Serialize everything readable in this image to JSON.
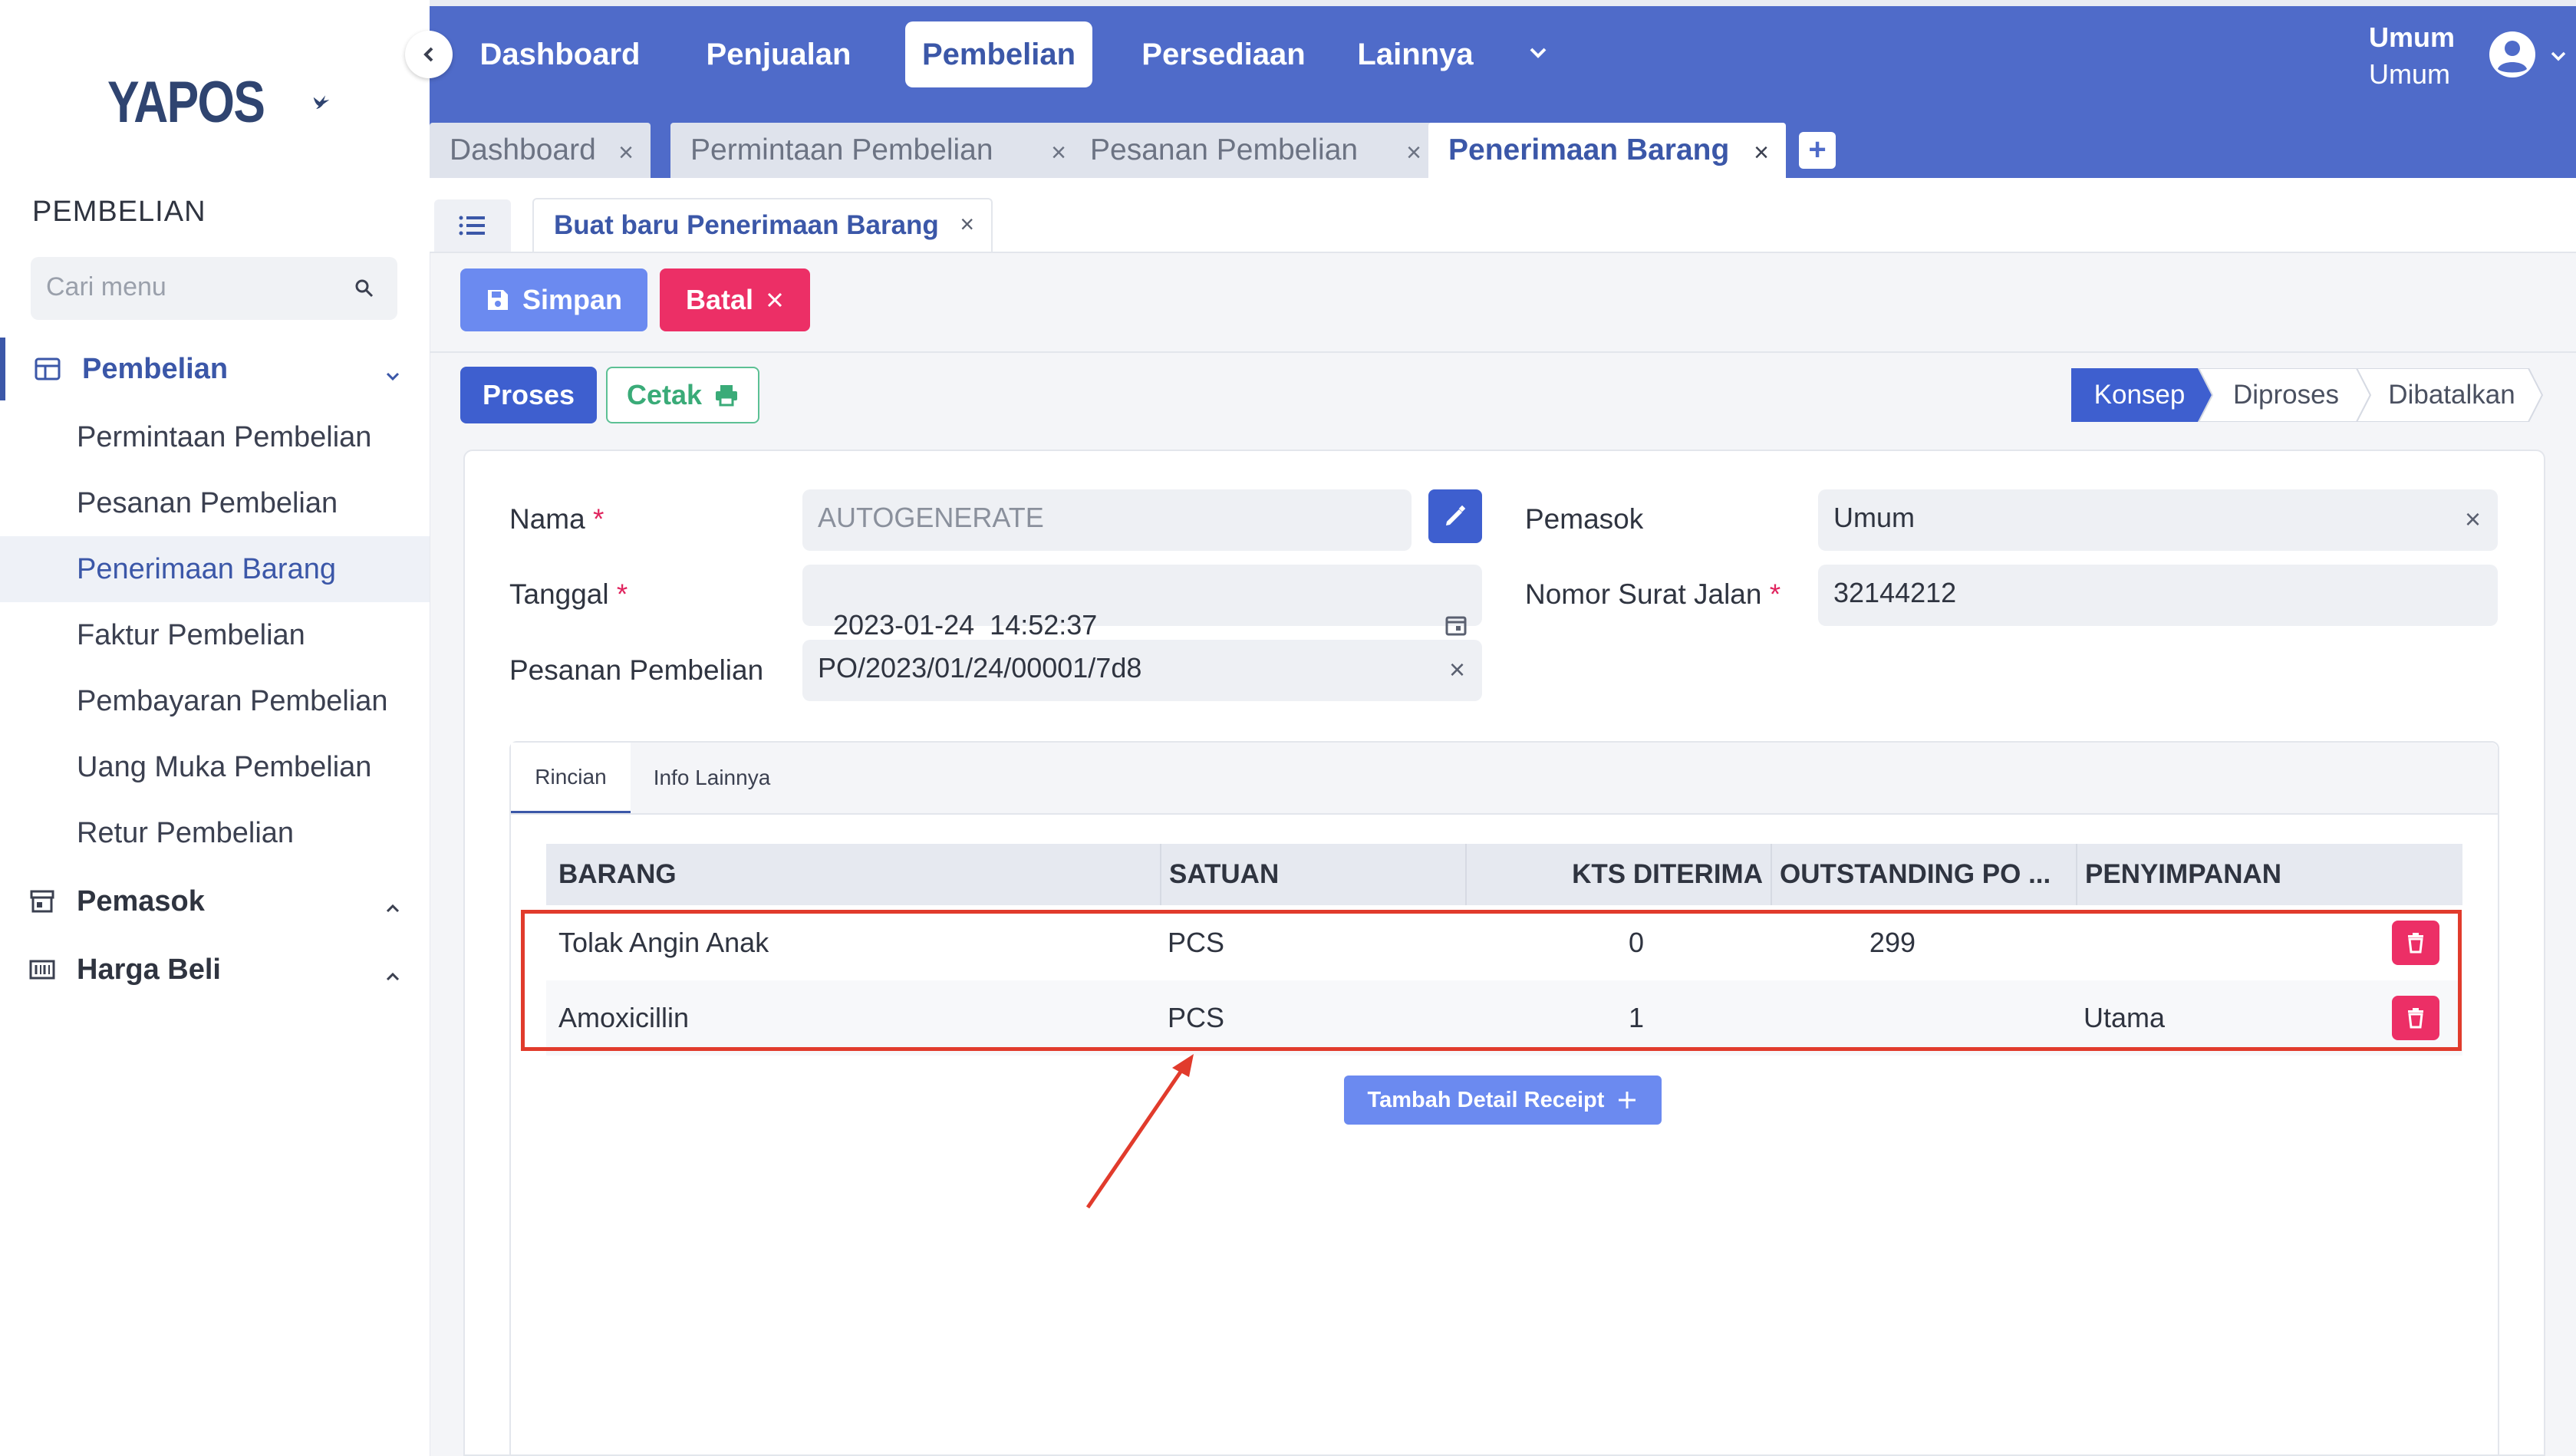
{
  "brand": {
    "logo_text": "YAPOS"
  },
  "sidebar": {
    "section_title": "PEMBELIAN",
    "search_placeholder": "Cari menu",
    "groups": [
      {
        "label": "Pembelian",
        "icon": "table-icon",
        "expanded": true
      },
      {
        "label": "Pemasok",
        "icon": "store-icon",
        "expanded": false
      },
      {
        "label": "Harga Beli",
        "icon": "barcode-icon",
        "expanded": false
      }
    ],
    "items": [
      {
        "label": "Permintaan Pembelian"
      },
      {
        "label": "Pesanan Pembelian"
      },
      {
        "label": "Penerimaan Barang",
        "active": true
      },
      {
        "label": "Faktur Pembelian"
      },
      {
        "label": "Pembayaran Pembelian"
      },
      {
        "label": "Uang Muka Pembelian"
      },
      {
        "label": "Retur Pembelian"
      }
    ]
  },
  "topnav": {
    "items": [
      {
        "label": "Dashboard"
      },
      {
        "label": "Penjualan"
      },
      {
        "label": "Pembelian",
        "active": true
      },
      {
        "label": "Persediaan"
      },
      {
        "label": "Lainnya"
      }
    ],
    "user": {
      "name": "Umum",
      "role": "Umum"
    }
  },
  "doc_tabs": [
    {
      "label": "Dashboard",
      "close": "×"
    },
    {
      "label": "Permintaan Pembelian",
      "close": "×"
    },
    {
      "label": "Pesanan Pembelian",
      "close": "×"
    },
    {
      "label": "Penerimaan Barang",
      "close": "×",
      "active": true
    }
  ],
  "add_tab_label": "+",
  "subtab": {
    "label": "Buat baru Penerimaan Barang",
    "close": "×"
  },
  "actions": {
    "save": "Simpan",
    "cancel": "Batal",
    "process": "Proses",
    "print": "Cetak"
  },
  "status_steps": [
    {
      "label": "Konsep",
      "active": true
    },
    {
      "label": "Diproses"
    },
    {
      "label": "Dibatalkan"
    }
  ],
  "form": {
    "nama_label": "Nama",
    "nama_value": "AUTOGENERATE",
    "tanggal_label": "Tanggal",
    "tanggal_value": "2023-01-24  14:52:37",
    "pesanan_label": "Pesanan Pembelian",
    "pesanan_value": "PO/2023/01/24/00001/7d8",
    "pemasok_label": "Pemasok",
    "pemasok_value": "Umum",
    "surat_label": "Nomor Surat Jalan",
    "surat_value": "32144212",
    "required_mark": "*",
    "clear_mark": "×"
  },
  "inner_tabs": [
    {
      "label": "Rincian",
      "active": true
    },
    {
      "label": "Info Lainnya"
    }
  ],
  "table": {
    "columns": [
      "BARANG",
      "SATUAN",
      "KTS DITERIMA",
      "OUTSTANDING PO ...",
      "PENYIMPANAN"
    ],
    "rows": [
      {
        "barang": "Tolak Angin Anak",
        "satuan": "PCS",
        "kts": "0",
        "outstanding": "299",
        "penyimpanan": ""
      },
      {
        "barang": "Amoxicillin",
        "satuan": "PCS",
        "kts": "1",
        "outstanding": "",
        "penyimpanan": "Utama"
      }
    ]
  },
  "add_detail_label": "Tambah Detail Receipt",
  "colors": {
    "primary": "#4f6bc9",
    "accent_blue": "#3e5fcf",
    "danger": "#ec2f66",
    "success": "#3aab78",
    "annotation_red": "#e13b2c"
  }
}
